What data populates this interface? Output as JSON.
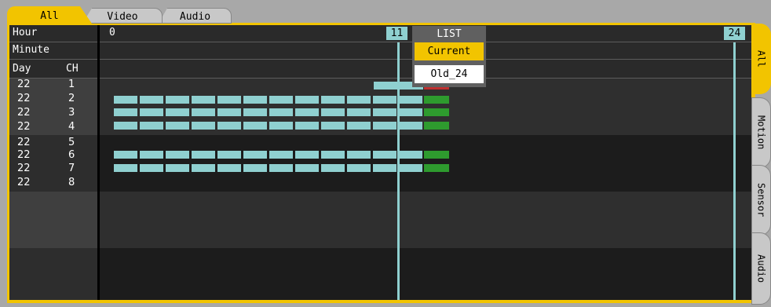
{
  "top_tabs": [
    {
      "label": "All",
      "active": true
    },
    {
      "label": "Video",
      "active": false
    },
    {
      "label": "Audio",
      "active": false
    }
  ],
  "header": {
    "hour_label": "Hour",
    "minute_label": "Minute",
    "day_label": "Day",
    "ch_label": "CH",
    "hour_start": "0",
    "current_hour": "11",
    "hour_end": "24"
  },
  "rows": [
    {
      "day": "22",
      "ch": "1"
    },
    {
      "day": "22",
      "ch": "2"
    },
    {
      "day": "22",
      "ch": "3"
    },
    {
      "day": "22",
      "ch": "4"
    },
    {
      "day": "22",
      "ch": "5"
    },
    {
      "day": "22",
      "ch": "6"
    },
    {
      "day": "22",
      "ch": "7"
    },
    {
      "day": "22",
      "ch": "8"
    }
  ],
  "side_tabs": [
    {
      "label": "All",
      "active": true
    },
    {
      "label": "Motion",
      "active": false
    },
    {
      "label": "Sensor",
      "active": false
    },
    {
      "label": "Audio",
      "active": false
    }
  ],
  "list_popup": {
    "title": "LIST",
    "items": [
      "Current",
      "Old_24"
    ],
    "selected": "Current"
  },
  "colors": {
    "accent": "#f2c400",
    "record_normal": "#8fd0d0",
    "record_current": "#2e9b2e",
    "record_red": "#c03030"
  }
}
